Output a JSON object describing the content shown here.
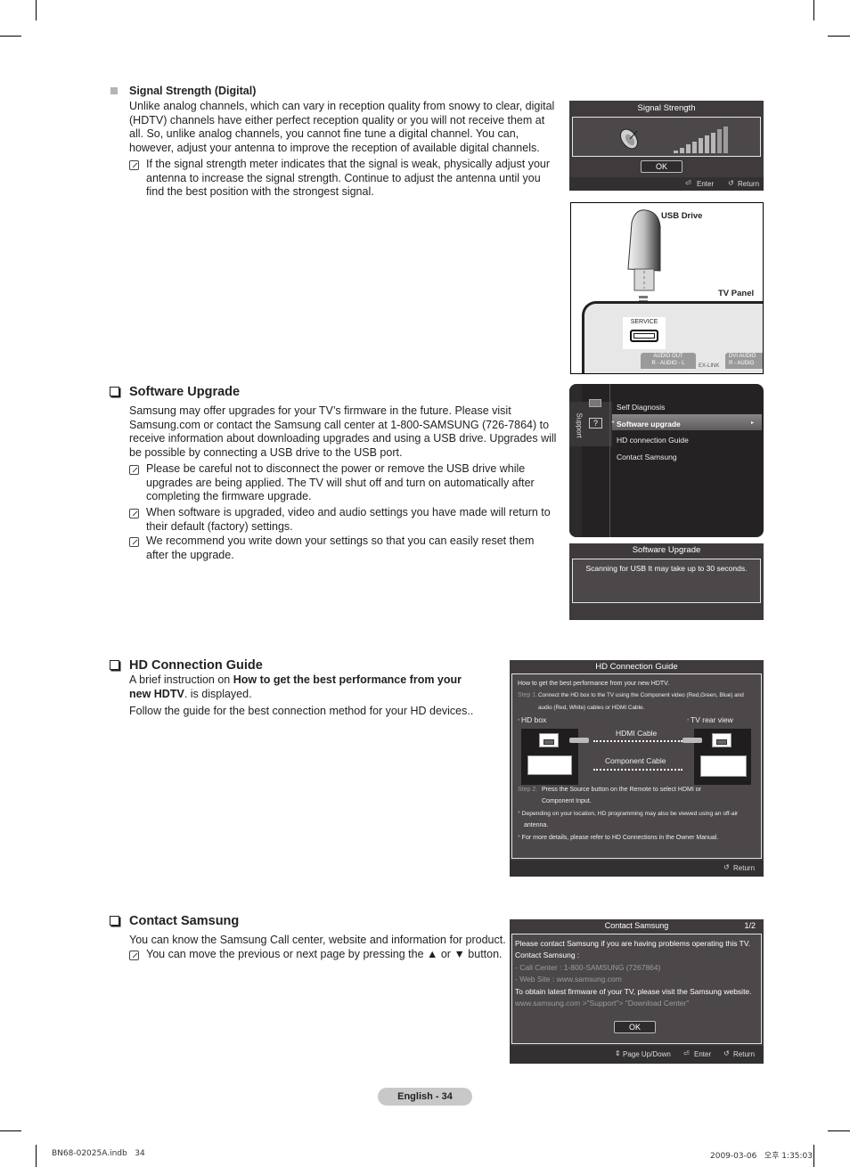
{
  "signal_section": {
    "title": "Signal Strength (Digital)",
    "body": "Unlike analog channels, which can vary in reception quality from snowy to clear, digital (HDTV) channels have either perfect reception quality or you will not receive them at all. So, unlike analog channels, you cannot fine tune a digital channel. You can, however, adjust your antenna to improve the reception of available digital channels.",
    "notes": [
      "If the signal strength meter indicates that the signal is weak, physically adjust your antenna to increase the signal strength. Continue to adjust the antenna until you find the best position with the strongest signal."
    ]
  },
  "signal_osd": {
    "title": "Signal Strength",
    "level_bars_lit": 9,
    "level_bars_total": 9,
    "ok_label": "OK",
    "footer": {
      "enter": "Enter",
      "return": "Return"
    }
  },
  "usb_diagram": {
    "usb_drive_label": "USB Drive",
    "tv_panel_label": "TV Panel",
    "service_label": "SERVICE",
    "audio_out_label": "AUDIO OUT",
    "audio_label": "R - AUDIO - L",
    "exlink_label": "EX-LINK",
    "dvi_audio_label": "DVI AUDIO",
    "dvi_audio_sub": "R - AUDIO"
  },
  "software_section": {
    "title": "Software Upgrade",
    "body": "Samsung may offer upgrades for your TV’s firmware in the future. Please visit Samsung.com or contact the Samsung call center at 1-800-SAMSUNG (726-7864) to receive information about downloading upgrades and using a USB drive. Upgrades will be possible by connecting a USB drive to the USB port.",
    "notes": [
      "Please be careful not to disconnect the power or remove the USB drive while upgrades are being applied. The TV will shut off and turn on automatically after completing the firmware upgrade.",
      "When software is upgraded, video and audio settings you have made will return to their default (factory) settings.",
      "We recommend you write down your settings so that you can easily reset them after the upgrade."
    ]
  },
  "support_menu": {
    "category": "Support",
    "items": [
      {
        "label": "Self Diagnosis",
        "selected": false
      },
      {
        "label": "Software upgrade",
        "selected": true
      },
      {
        "label": "HD connection Guide",
        "selected": false
      },
      {
        "label": "Contact Samsung",
        "selected": false
      }
    ]
  },
  "upgrade_osd": {
    "title": "Software Upgrade",
    "message": "Scanning for USB It may take up to 30 seconds."
  },
  "hd_section": {
    "title": "HD Connection Guide",
    "intro_prefix": "A brief instruction on ",
    "intro_bold": "How to get the best performance from your new HDTV",
    "intro_suffix": ". is displayed.",
    "body2": "Follow the guide for the best connection method for your HD devices.."
  },
  "hd_osd": {
    "title": "HD Connection Guide",
    "heading": "How to get the best performance from your new HDTV.",
    "step1_label": "Step 1.",
    "step1_line1": "Connect the HD box to the TV using the Component video (Red,Green, Blue) and",
    "step1_line2": "audio (Red, White) cables or HDMI Cable.",
    "hd_box_label": "HD box",
    "tv_rear_label": "TV rear view",
    "hdmi_cable_label": "HDMI Cable",
    "component_cable_label": "Component Cable",
    "step2_label": "Step 2.",
    "step2_line1": "Press the Source button on the Remote to select HDMI or",
    "step2_line2": "Component Input.",
    "bullet1_line1": "Depending on your location, HD programming may also be viewed using an off-air",
    "bullet1_line2": "antenna.",
    "bullet2": "For more details, please refer to HD Connections in the Owner Manual.",
    "footer_return": "Return"
  },
  "contact_section": {
    "title": "Contact Samsung",
    "body": "You can know the Samsung Call center, website and information for product.",
    "notes": [
      "You can move the previous or next page by pressing the ▲ or ▼ button."
    ]
  },
  "contact_osd": {
    "title": "Contact Samsung",
    "page": "1/2",
    "line1": "Please contact Samsung if you are having problems operating this TV.",
    "line2": "Contact Samsung :",
    "line3": " - Call Center : 1-800-SAMSUNG (7267864)",
    "line4": " - Web Site : www.samsung.com",
    "line5": "To obtain latest firmware of your TV, please visit the Samsung website.",
    "line6": "www.samsung.com >\"Support\"> \"Download Center\"",
    "ok_label": "OK",
    "footer": {
      "page": "Page Up/Down",
      "enter": "Enter",
      "return": "Return"
    }
  },
  "footer": {
    "page_label": "English - 34",
    "file_info": "BN68-02025A.indb   34",
    "timestamp": "2009-03-06   오후 1:35:03"
  }
}
